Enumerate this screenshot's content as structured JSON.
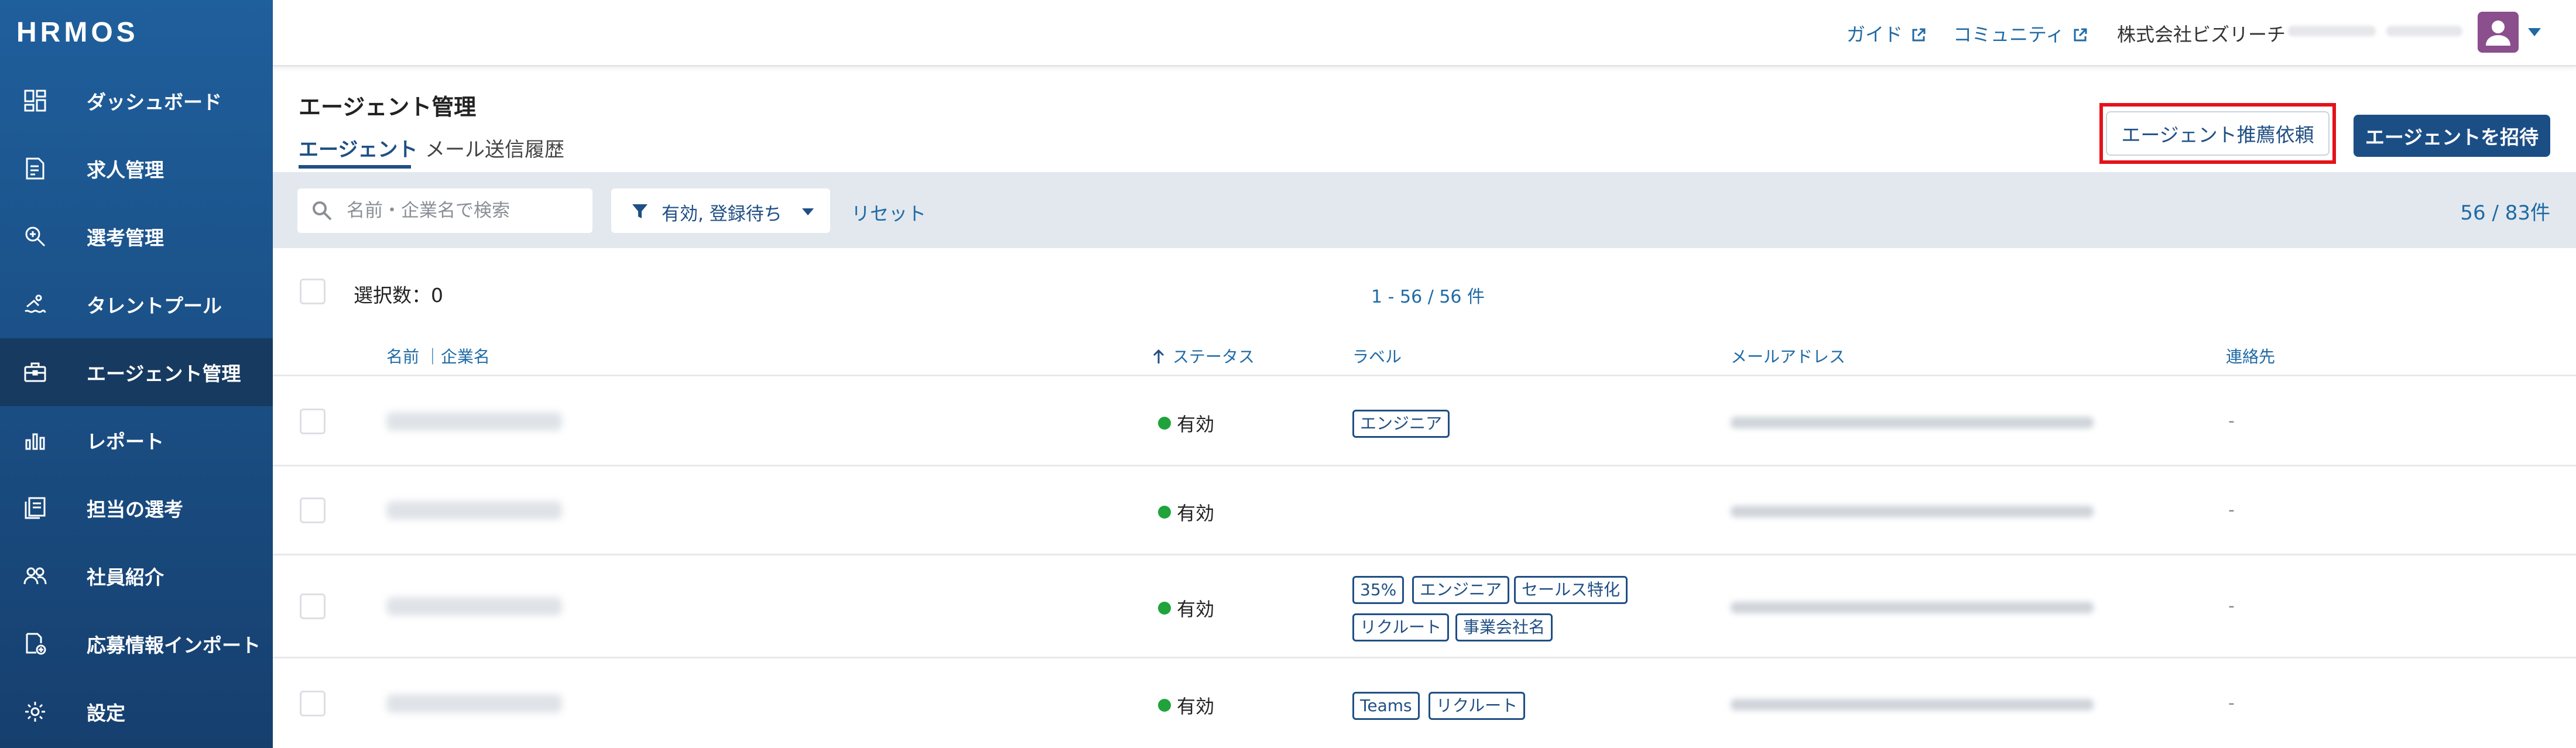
{
  "app": {
    "logo": "HRMOS"
  },
  "sidebar": {
    "items": [
      {
        "label": "ダッシュボード",
        "icon": "dashboard-icon"
      },
      {
        "label": "求人管理",
        "icon": "job-document-icon"
      },
      {
        "label": "選考管理",
        "icon": "search-magnify-icon"
      },
      {
        "label": "タレントプール",
        "icon": "swimmer-icon"
      },
      {
        "label": "エージェント管理",
        "icon": "briefcase-icon",
        "active": true
      },
      {
        "label": "レポート",
        "icon": "bar-chart-icon"
      },
      {
        "label": "担当の選考",
        "icon": "assigned-docs-icon"
      },
      {
        "label": "社員紹介",
        "icon": "people-icon"
      },
      {
        "label": "応募情報インポート",
        "icon": "import-icon"
      },
      {
        "label": "設定",
        "icon": "gear-icon"
      }
    ]
  },
  "header": {
    "guide": "ガイド",
    "community": "コミュニティ",
    "company": "株式会社ビズリーチ"
  },
  "page": {
    "title": "エージェント管理",
    "tabs": [
      "エージェント",
      "メール送信履歴"
    ],
    "recommend_button": "エージェント推薦依頼",
    "invite_button": "エージェントを招待"
  },
  "filters": {
    "search_placeholder": "名前・企業名で検索",
    "status_filter": "有効, 登録待ち",
    "reset": "リセット",
    "total": "56 / 83件"
  },
  "table": {
    "selected_label": "選択数：0",
    "range": "1 - 56 / 56 件",
    "headers": {
      "name": "名前 ｜企業名",
      "status": "ステータス",
      "label": "ラベル",
      "email": "メールアドレス",
      "contact": "連絡先"
    },
    "rows": [
      {
        "status": "有効",
        "tags": [
          "エンジニア"
        ],
        "contact": "-"
      },
      {
        "status": "有効",
        "tags": [],
        "contact": "-"
      },
      {
        "status": "有効",
        "tags": [
          "35%",
          "エンジニア",
          "セールス特化",
          "リクルート",
          "事業会社名"
        ],
        "contact": "-"
      },
      {
        "status": "有効",
        "tags": [
          "Teams",
          "リクルート"
        ],
        "contact": "-"
      }
    ]
  },
  "colors": {
    "sidebar_top": "#1f5f9c",
    "sidebar_bottom": "#163f6e",
    "primary": "#1c4e86",
    "link": "#1f6aa5",
    "status_active": "#1fa33a",
    "highlight": "#e3121a"
  }
}
